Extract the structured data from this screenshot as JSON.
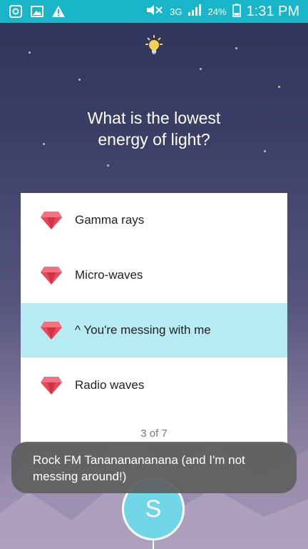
{
  "status_bar": {
    "network": "3G",
    "battery": "24%",
    "time": "1:31 PM"
  },
  "question": {
    "line1": "What is the lowest",
    "line2": "energy of light?"
  },
  "answers": [
    {
      "label": "Gamma rays",
      "selected": false
    },
    {
      "label": "Micro-waves",
      "selected": false
    },
    {
      "label": "^ You're messing with me",
      "selected": true
    },
    {
      "label": "Radio waves",
      "selected": false
    }
  ],
  "progress": "3 of 7",
  "toast": {
    "text": "Rock FM Tanananananana (and I'm not messing around!)"
  },
  "avatar": {
    "initial": "S"
  },
  "colors": {
    "status_bar": "#19b6c9",
    "selected_answer": "#b7ebf3",
    "gem": "#e8485a",
    "avatar": "#72d6e9"
  },
  "icons": [
    "chat-app-icon",
    "gallery-icon",
    "warning-icon",
    "mute-icon",
    "signal-icon",
    "battery-icon",
    "lightbulb-icon",
    "moon-icon",
    "gem-icon"
  ]
}
